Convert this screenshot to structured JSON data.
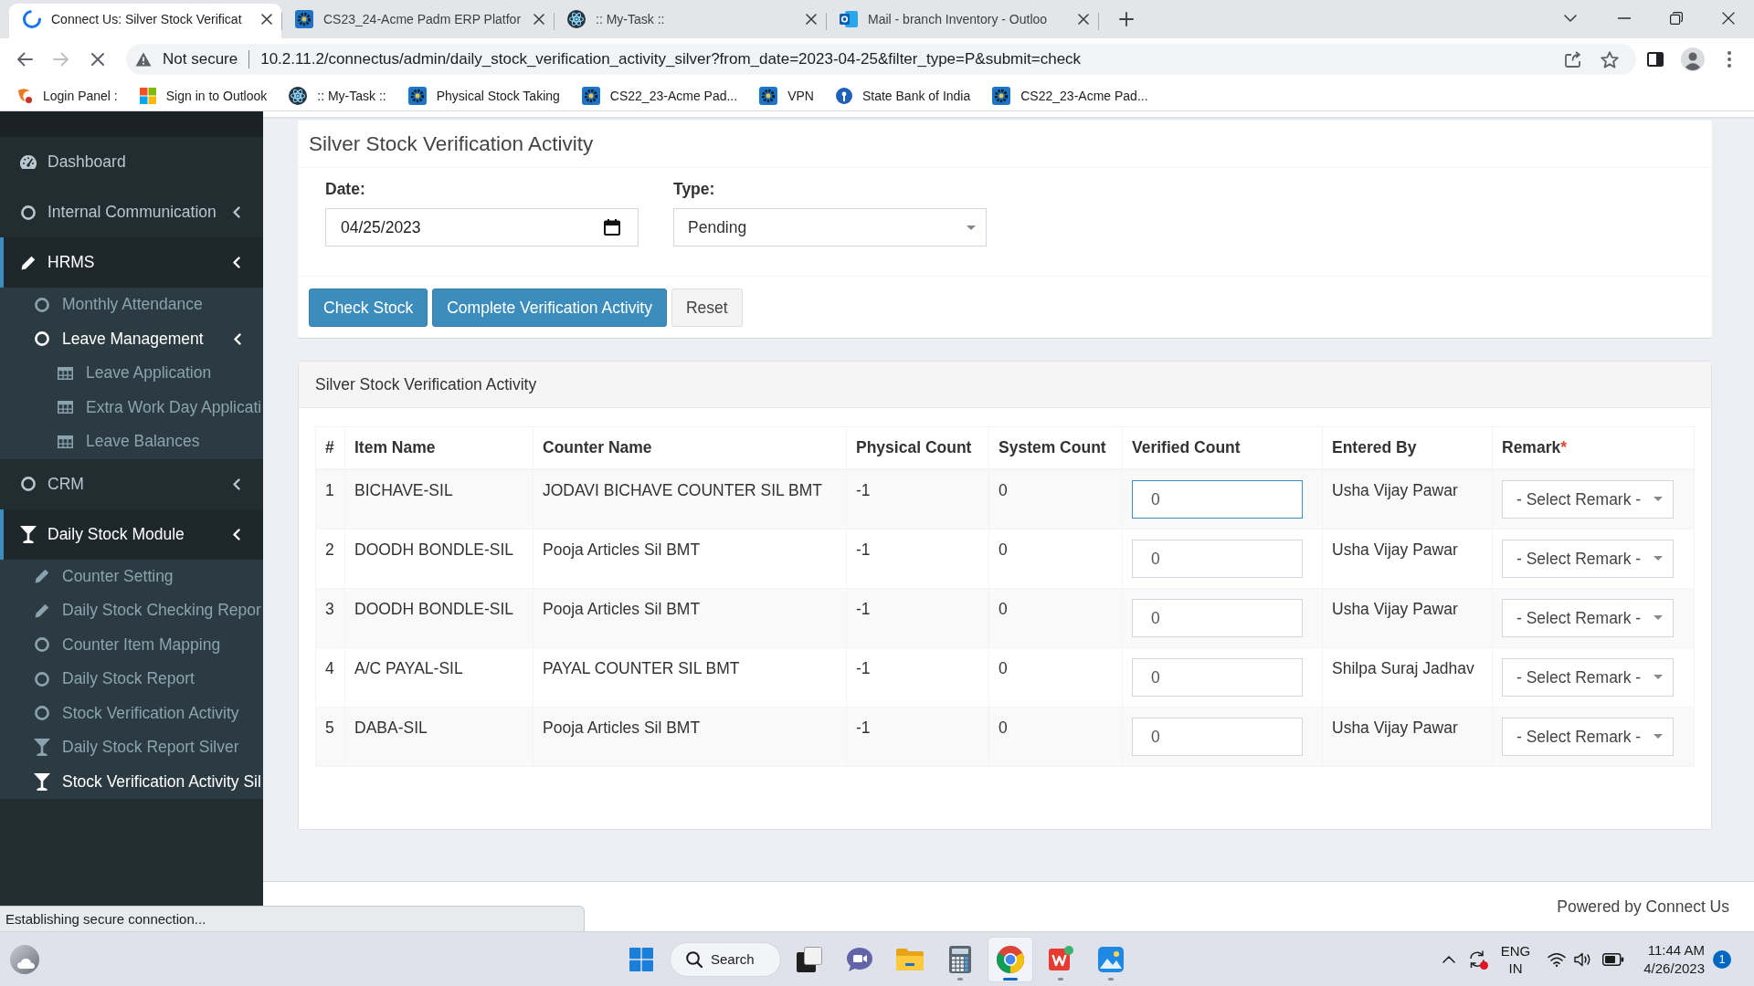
{
  "browser": {
    "tabs": [
      {
        "title": "Connect Us: Silver Stock Verificat",
        "kind": "loading",
        "selected": true
      },
      {
        "title": "CS23_24-Acme Padm ERP Platfor",
        "kind": "erp",
        "selected": false
      },
      {
        "title": ":: My-Task ::",
        "kind": "task",
        "selected": false
      },
      {
        "title": "Mail - branch Inventory - Outloo",
        "kind": "mail",
        "selected": false
      }
    ],
    "toolbar": {
      "back_disabled": false,
      "forward_disabled": true,
      "loading": true,
      "security_label": "Not secure",
      "url": "10.2.11.2/connectus/admin/daily_stock_verification_activity_silver?from_date=2023-04-25&filter_type=P&submit=check"
    },
    "bookmarks": [
      {
        "label": "Login Panel :",
        "kind": "login"
      },
      {
        "label": "Sign in to Outlook",
        "kind": "squares"
      },
      {
        "label": ":: My-Task ::",
        "kind": "task"
      },
      {
        "label": "Physical Stock Taking",
        "kind": "erp"
      },
      {
        "label": "CS22_23-Acme Pad...",
        "kind": "erp"
      },
      {
        "label": "VPN",
        "kind": "erp"
      },
      {
        "label": "State Bank of India",
        "kind": "bank"
      },
      {
        "label": "CS22_23-Acme Pad...",
        "kind": "erp"
      }
    ]
  },
  "sidebar": {
    "items": [
      {
        "label": "Dashboard",
        "kind": "dashboard",
        "selected": false
      },
      {
        "label": "Internal Communication",
        "kind": "circle",
        "expanded": false
      },
      {
        "label": "HRMS",
        "kind": "pencil",
        "expanded": true,
        "children": [
          {
            "label": "Monthly Attendance",
            "kind": "circle",
            "selected": false
          },
          {
            "label": "Leave Management",
            "kind": "circle",
            "expanded": true,
            "children": [
              {
                "label": "Leave Application",
                "kind": "grid",
                "selected": false
              },
              {
                "label": "Extra Work Day Applicati",
                "kind": "grid",
                "selected": false
              },
              {
                "label": "Leave Balances",
                "kind": "grid",
                "selected": false
              }
            ]
          }
        ]
      },
      {
        "label": "CRM",
        "kind": "circle",
        "expanded": false
      },
      {
        "label": "Daily Stock Module",
        "kind": "glass",
        "expanded": true,
        "children": [
          {
            "label": "Counter Setting",
            "kind": "pencil",
            "selected": false
          },
          {
            "label": "Daily Stock Checking Repor",
            "kind": "pencil",
            "selected": false
          },
          {
            "label": "Counter Item Mapping",
            "kind": "circle",
            "selected": false
          },
          {
            "label": "Daily Stock Report",
            "kind": "circle",
            "selected": false
          },
          {
            "label": "Stock Verification Activity",
            "kind": "circle",
            "selected": false
          },
          {
            "label": "Daily Stock Report Silver",
            "kind": "glass",
            "selected": false
          },
          {
            "label": "Stock Verification Activity Sil",
            "kind": "glass",
            "selected": true
          }
        ]
      }
    ]
  },
  "form_box": {
    "title": "Silver Stock Verification Activity",
    "fields": [
      {
        "label": "Date:",
        "kind": "date",
        "value": "04/25/2023"
      },
      {
        "label": "Type:",
        "kind": "select",
        "value": "Pending"
      }
    ],
    "buttons": [
      {
        "label": "Check Stock",
        "kind": "primary"
      },
      {
        "label": "Complete Verification Activity",
        "kind": "primary"
      },
      {
        "label": "Reset",
        "kind": "default"
      }
    ]
  },
  "table_box": {
    "title": "Silver Stock Verification Activity",
    "columns": [
      {
        "label": "#"
      },
      {
        "label": "Item Name"
      },
      {
        "label": "Counter Name"
      },
      {
        "label": "Physical Count"
      },
      {
        "label": "System Count"
      },
      {
        "label": "Verified Count"
      },
      {
        "label": "Entered By"
      },
      {
        "label": "Remark",
        "required_mark": "*"
      }
    ],
    "rows": [
      {
        "number": "1",
        "item_name": "BICHAVE-SIL",
        "counter_name": "JODAVI BICHAVE COUNTER SIL BMT",
        "physical_count": "-1",
        "system_count": "0",
        "verified_count": "0",
        "focused": true,
        "entered_by": "Usha Vijay Pawar",
        "remark": "- Select Remark -"
      },
      {
        "number": "2",
        "item_name": "DOODH BONDLE-SIL",
        "counter_name": "Pooja Articles Sil BMT",
        "physical_count": "-1",
        "system_count": "0",
        "verified_count": "0",
        "focused": false,
        "entered_by": "Usha Vijay Pawar",
        "remark": "- Select Remark -"
      },
      {
        "number": "3",
        "item_name": "DOODH BONDLE-SIL",
        "counter_name": "Pooja Articles Sil BMT",
        "physical_count": "-1",
        "system_count": "0",
        "verified_count": "0",
        "focused": false,
        "entered_by": "Usha Vijay Pawar",
        "remark": "- Select Remark -"
      },
      {
        "number": "4",
        "item_name": "A/C PAYAL-SIL",
        "counter_name": "PAYAL COUNTER SIL BMT",
        "physical_count": "-1",
        "system_count": "0",
        "verified_count": "0",
        "focused": false,
        "entered_by": "Shilpa Suraj Jadhav",
        "remark": "- Select Remark -"
      },
      {
        "number": "5",
        "item_name": "DABA-SIL",
        "counter_name": "Pooja Articles Sil BMT",
        "physical_count": "-1",
        "system_count": "0",
        "verified_count": "0",
        "focused": false,
        "entered_by": "Usha Vijay Pawar",
        "remark": "- Select Remark -"
      }
    ]
  },
  "footer": {
    "powered_by": "Powered by Connect Us"
  },
  "status_bubble": {
    "text": "Establishing secure connection..."
  },
  "taskbar": {
    "search_label": "Search",
    "apps": [
      {
        "kind": "squares",
        "running": false,
        "selected": false
      },
      {
        "kind": "chat",
        "running": false,
        "selected": false
      },
      {
        "kind": "folder",
        "running": false,
        "selected": false
      },
      {
        "kind": "calculator",
        "running": true,
        "selected": false
      },
      {
        "kind": "browser",
        "running": true,
        "selected": true
      },
      {
        "kind": "office",
        "running": true,
        "selected": false
      },
      {
        "kind": "photos",
        "running": true,
        "selected": false
      }
    ],
    "tray": {
      "language": "ENG",
      "region": "IN",
      "time": "11:44 AM",
      "date": "4/26/2023",
      "notification_count": "1"
    }
  }
}
